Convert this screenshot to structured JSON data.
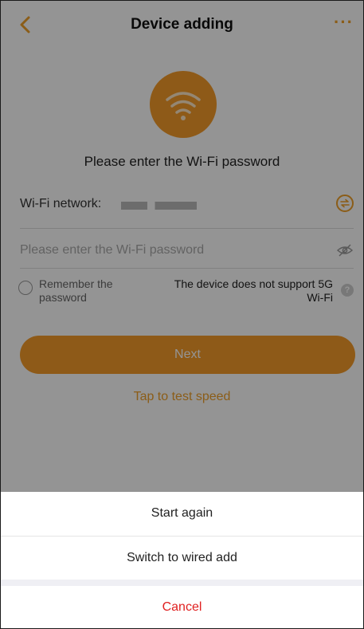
{
  "header": {
    "title": "Device adding",
    "more_label": "···"
  },
  "main": {
    "prompt": "Please enter the Wi-Fi password",
    "network_label": "Wi-Fi network:",
    "password_placeholder": "Please enter the Wi-Fi password",
    "remember_label": "Remember the password",
    "support_note": "The device does not support 5G Wi-Fi",
    "help_icon_label": "?",
    "next_label": "Next",
    "speed_test_label": "Tap to test speed"
  },
  "action_sheet": {
    "items": [
      {
        "label": "Start again"
      },
      {
        "label": "Switch to wired add"
      }
    ],
    "cancel_label": "Cancel"
  },
  "colors": {
    "accent": "#f59c2a",
    "cancel": "#e02020",
    "overlay": "rgba(0,0,0,0.42)"
  },
  "icons": {
    "back": "chevron-left-icon",
    "more": "more-icon",
    "wifi": "wifi-icon",
    "swap": "swap-icon",
    "eye": "eye-hidden-icon",
    "help": "help-icon"
  }
}
